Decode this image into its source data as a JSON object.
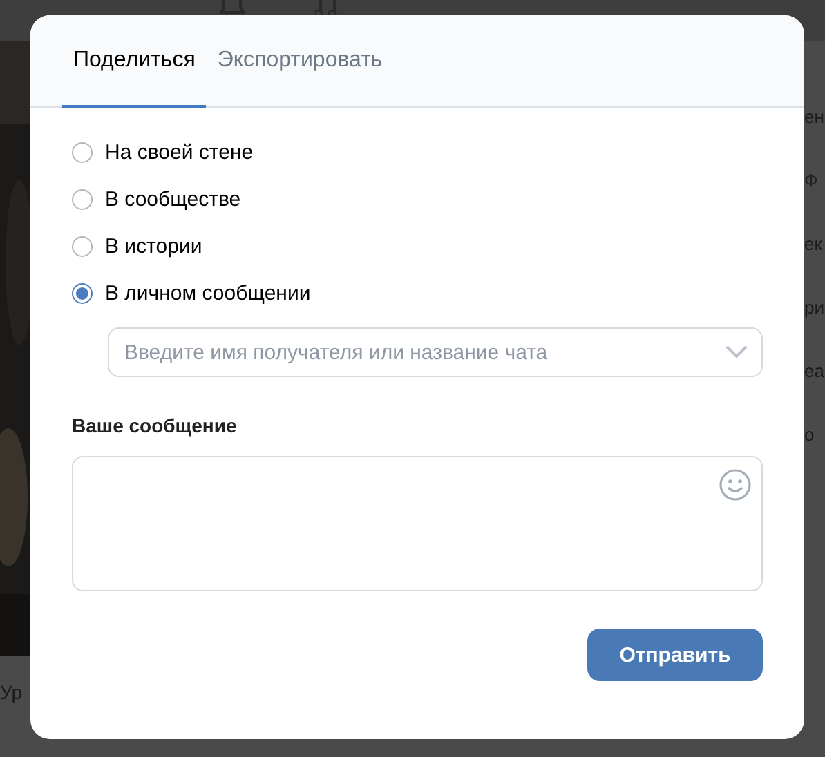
{
  "background": {
    "left_caption": "Ур",
    "right_fragments": [
      "ен",
      "Ф",
      "ек",
      "ри",
      "еа",
      "о"
    ]
  },
  "tabs": [
    {
      "label": "Поделиться",
      "selected": true
    },
    {
      "label": "Экспортировать",
      "selected": false
    }
  ],
  "share_options": [
    {
      "label": "На своей стене",
      "selected": false
    },
    {
      "label": "В сообществе",
      "selected": false
    },
    {
      "label": "В истории",
      "selected": false
    },
    {
      "label": "В личном сообщении",
      "selected": true
    }
  ],
  "recipient_field": {
    "placeholder": "Введите имя получателя или название чата"
  },
  "message": {
    "label": "Ваше сообщение"
  },
  "send_button": "Отправить"
}
